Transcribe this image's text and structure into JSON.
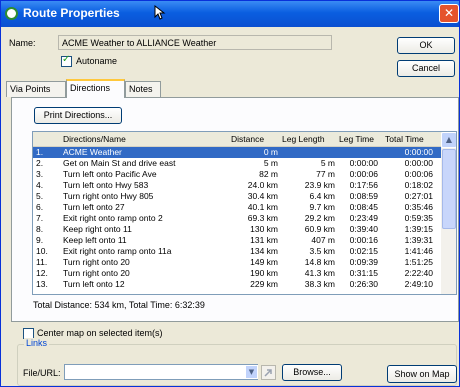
{
  "window": {
    "title": "Route Properties",
    "close_glyph": "✕"
  },
  "name_label": "Name:",
  "name_value": "ACME Weather to ALLIANCE Weather",
  "autoname_label": "Autoname",
  "buttons": {
    "ok": "OK",
    "cancel": "Cancel",
    "print": "Print Directions...",
    "browse": "Browse...",
    "show_on_map": "Show on Map"
  },
  "tabs": [
    {
      "label": "Via Points"
    },
    {
      "label": "Directions"
    },
    {
      "label": "Notes"
    }
  ],
  "columns": [
    "Directions/Name",
    "Distance",
    "Leg Length",
    "Leg Time",
    "Total Time"
  ],
  "rows": [
    {
      "n": "1.",
      "name": "ACME Weather",
      "dist": "0 m",
      "leg": "",
      "legtime": "",
      "total": "0:00:00"
    },
    {
      "n": "2.",
      "name": "Get on Main St and drive east",
      "dist": "5 m",
      "leg": "5 m",
      "legtime": "0:00:00",
      "total": "0:00:00"
    },
    {
      "n": "3.",
      "name": "Turn left onto Pacific Ave",
      "dist": "82 m",
      "leg": "77 m",
      "legtime": "0:00:06",
      "total": "0:00:06"
    },
    {
      "n": "4.",
      "name": "Turn left onto Hwy 583",
      "dist": "24.0 km",
      "leg": "23.9 km",
      "legtime": "0:17:56",
      "total": "0:18:02"
    },
    {
      "n": "5.",
      "name": "Turn right onto Hwy 805",
      "dist": "30.4 km",
      "leg": "6.4 km",
      "legtime": "0:08:59",
      "total": "0:27:01"
    },
    {
      "n": "6.",
      "name": "Turn left onto  27",
      "dist": "40.1 km",
      "leg": "9.7 km",
      "legtime": "0:08:45",
      "total": "0:35:46"
    },
    {
      "n": "7.",
      "name": "Exit right onto ramp onto  2",
      "dist": "69.3 km",
      "leg": "29.2 km",
      "legtime": "0:23:49",
      "total": "0:59:35"
    },
    {
      "n": "8.",
      "name": "Keep right onto  11",
      "dist": "130 km",
      "leg": "60.9 km",
      "legtime": "0:39:40",
      "total": "1:39:15"
    },
    {
      "n": "9.",
      "name": "Keep left onto  11",
      "dist": "131 km",
      "leg": "407 m",
      "legtime": "0:00:16",
      "total": "1:39:31"
    },
    {
      "n": "10.",
      "name": "Exit right onto ramp onto  11a",
      "dist": "134 km",
      "leg": "3.5 km",
      "legtime": "0:02:15",
      "total": "1:41:46"
    },
    {
      "n": "11.",
      "name": "Turn right onto  20",
      "dist": "149 km",
      "leg": "14.8 km",
      "legtime": "0:09:39",
      "total": "1:51:25"
    },
    {
      "n": "12.",
      "name": "Turn right onto  20",
      "dist": "190 km",
      "leg": "41.3 km",
      "legtime": "0:31:15",
      "total": "2:22:40"
    },
    {
      "n": "13.",
      "name": "Turn left onto  12",
      "dist": "229 km",
      "leg": "38.3 km",
      "legtime": "0:26:30",
      "total": "2:49:10"
    }
  ],
  "selected_row": 0,
  "summary": "Total Distance: 534 km, Total Time: 6:32:39",
  "center_map_label": "Center map on selected item(s)",
  "links": {
    "legend": "Links",
    "file_url_label": "File/URL:",
    "file_url_value": ""
  }
}
